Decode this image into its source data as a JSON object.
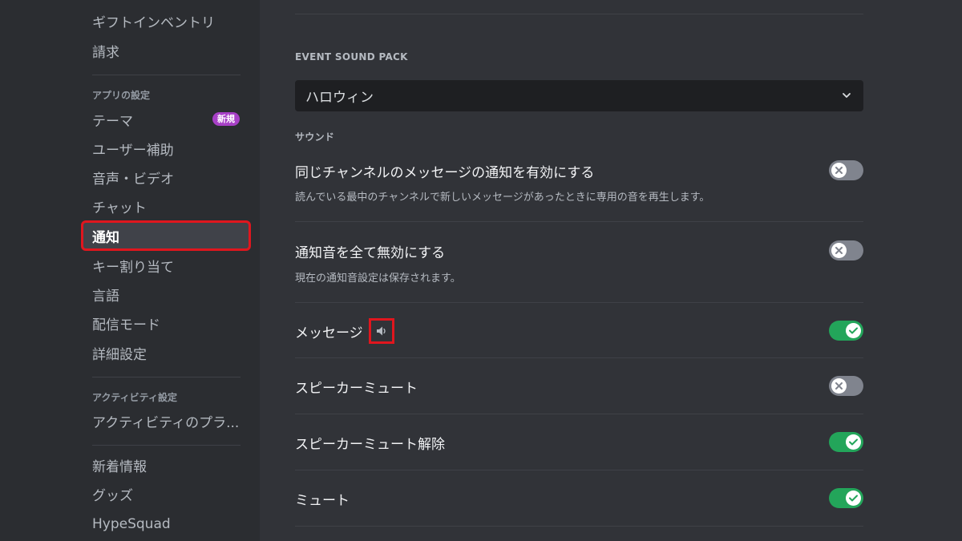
{
  "sidebar": {
    "items_top": [
      {
        "label": "ギフトインベントリ"
      },
      {
        "label": "請求"
      }
    ],
    "app_settings_header": "アプリの設定",
    "app_settings_items": [
      {
        "label": "テーマ",
        "badge": "新規"
      },
      {
        "label": "ユーザー補助"
      },
      {
        "label": "音声・ビデオ"
      },
      {
        "label": "チャット"
      },
      {
        "label": "通知",
        "selected": true
      },
      {
        "label": "キー割り当て"
      },
      {
        "label": "言語"
      },
      {
        "label": "配信モード"
      },
      {
        "label": "詳細設定"
      }
    ],
    "activity_header": "アクティビティ設定",
    "activity_items": [
      {
        "label": "アクティビティのプラ..."
      }
    ],
    "bottom_items": [
      {
        "label": "新着情報"
      },
      {
        "label": "グッズ"
      },
      {
        "label": "HypeSquad"
      }
    ]
  },
  "main": {
    "event_sound_pack": {
      "label": "EVENT SOUND PACK",
      "selected": "ハロウィン"
    },
    "sound_section_label": "サウンド",
    "settings": [
      {
        "title": "同じチャンネルのメッセージの通知を有効にする",
        "description": "読んでいる最中のチャンネルで新しいメッセージがあったときに専用の音を再生します。",
        "enabled": false
      },
      {
        "title": "通知音を全て無効にする",
        "description": "現在の通知音設定は保存されます。",
        "enabled": false
      },
      {
        "title": "メッセージ",
        "enabled": true
      },
      {
        "title": "スピーカーミュート",
        "enabled": false
      },
      {
        "title": "スピーカーミュート解除",
        "enabled": true
      },
      {
        "title": "ミュート",
        "enabled": true
      }
    ]
  },
  "colors": {
    "accent_green": "#23a55a",
    "toggle_off": "#80848e",
    "highlight_red": "#e0161e",
    "badge_purple": "#a740c6"
  },
  "icons": {
    "speaker": "speaker-icon",
    "chevron": "chevron-down-icon",
    "check": "check-icon",
    "cross": "x-icon"
  }
}
